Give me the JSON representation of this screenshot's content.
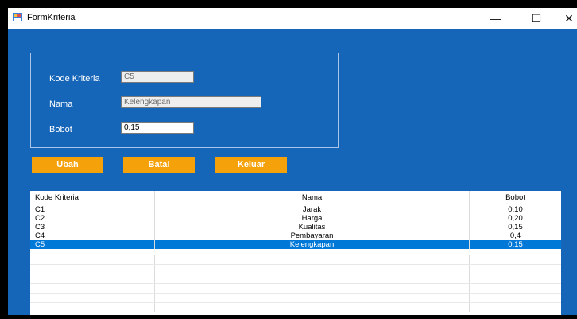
{
  "window": {
    "title": "FormKriteria",
    "minimize": "—",
    "maximize": "☐",
    "close": "✕"
  },
  "form": {
    "kode_label": "Kode Kriteria",
    "kode_value": "C5",
    "nama_label": "Nama",
    "nama_value": "Kelengkapan",
    "bobot_label": "Bobot",
    "bobot_value": "0,15"
  },
  "buttons": {
    "ubah": "Ubah",
    "batal": "Batal",
    "keluar": "Keluar"
  },
  "table": {
    "columns": [
      "Kode Kriteria",
      "Nama",
      "Bobot"
    ],
    "rows": [
      {
        "kode": "C1",
        "nama": "Jarak",
        "bobot": "0,10"
      },
      {
        "kode": "C2",
        "nama": "Harga",
        "bobot": "0,20"
      },
      {
        "kode": "C3",
        "nama": "Kualitas",
        "bobot": "0,15"
      },
      {
        "kode": "C4",
        "nama": "Pembayaran",
        "bobot": "0,4"
      },
      {
        "kode": "C5",
        "nama": "Kelengkapan",
        "bobot": "0,15"
      }
    ]
  },
  "colors": {
    "client_bg": "#1565b8",
    "button_bg": "#f5a10a",
    "selection": "#0078d7"
  }
}
